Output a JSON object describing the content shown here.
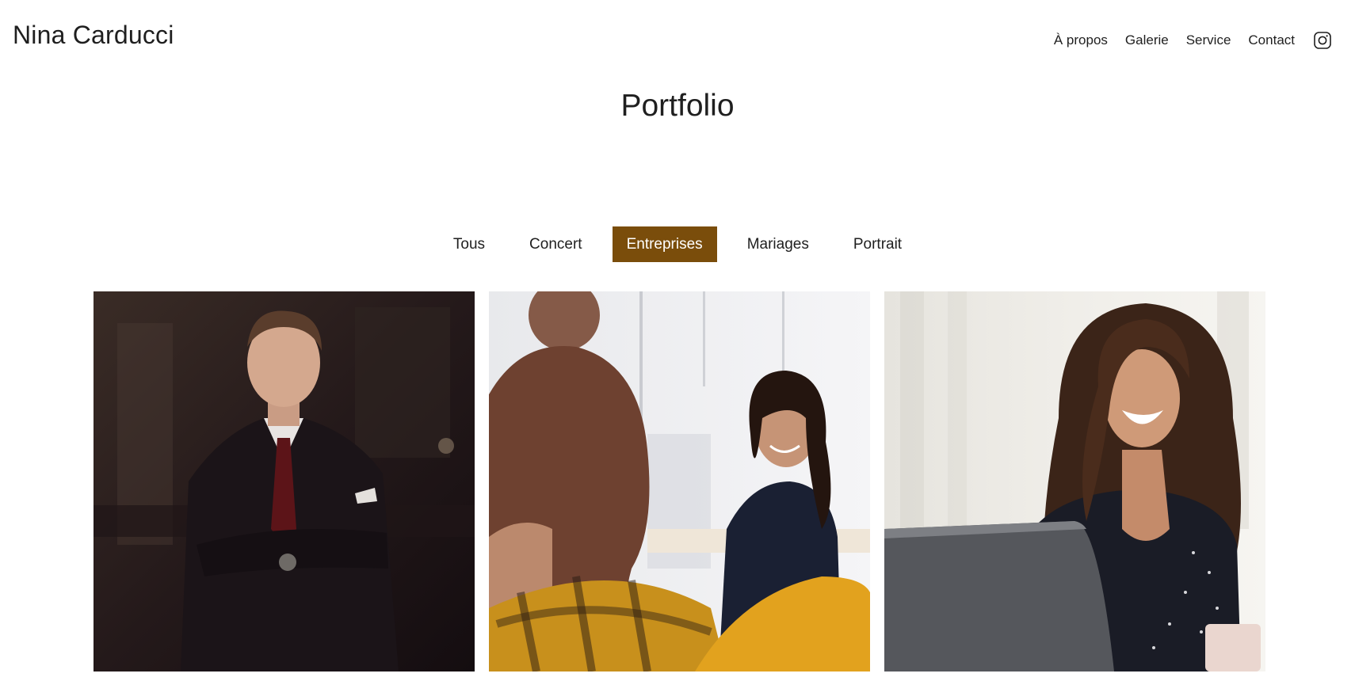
{
  "header": {
    "brand": "Nina Carducci",
    "nav": [
      {
        "label": "À propos"
      },
      {
        "label": "Galerie"
      },
      {
        "label": "Service"
      },
      {
        "label": "Contact"
      }
    ],
    "social_icon": "instagram-icon"
  },
  "portfolio": {
    "title": "Portfolio",
    "filters": [
      {
        "label": "Tous",
        "active": false
      },
      {
        "label": "Concert",
        "active": false
      },
      {
        "label": "Entreprises",
        "active": true
      },
      {
        "label": "Mariages",
        "active": false
      },
      {
        "label": "Portrait",
        "active": false
      }
    ],
    "images": [
      {
        "subject": "man-in-suit-portrait"
      },
      {
        "subject": "woman-smiling-in-office"
      },
      {
        "subject": "woman-laughing-at-laptop"
      }
    ]
  },
  "colors": {
    "accent": "#7a4d0b",
    "text": "#1f1f1f",
    "background": "#ffffff"
  }
}
